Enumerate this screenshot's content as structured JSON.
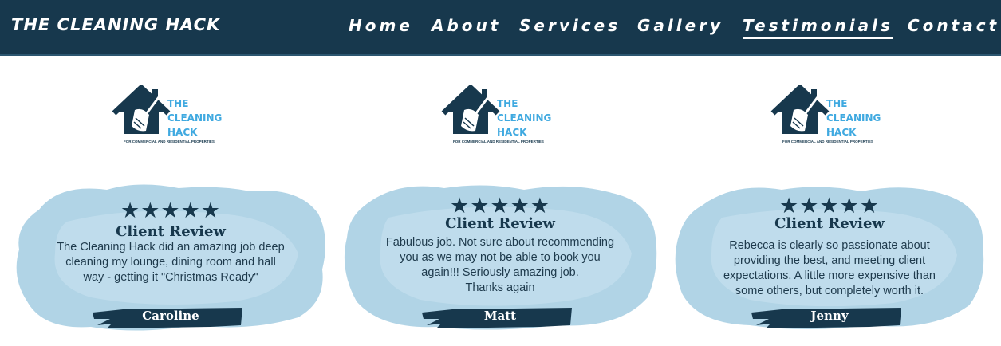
{
  "header": {
    "brand": "THE CLEANING HACK",
    "nav": [
      {
        "label": "Home"
      },
      {
        "label": "About"
      },
      {
        "label": "Services"
      },
      {
        "label": "Gallery"
      },
      {
        "label": "Testimonials",
        "active": true
      },
      {
        "label": "Contact"
      }
    ]
  },
  "logo": {
    "line1": "THE",
    "line2": "CLEANING",
    "line3": "HACK",
    "tagline": "FOR COMMERCIAL AND RESIDENTIAL PROPERTIES",
    "icon": "house-broom-icon"
  },
  "reviews": [
    {
      "stars": "★★★★★",
      "rating": 5,
      "title": "Client Review",
      "lines": [
        "The Cleaning Hack did an amazing job deep",
        "cleaning my lounge, dining room and hall",
        "way - getting it \"Christmas Ready\""
      ],
      "name": "Caroline"
    },
    {
      "stars": "★★★★★",
      "rating": 5,
      "title": "Client Review",
      "lines": [
        "Fabulous job. Not sure about recommending",
        "you as we may not be able to book you",
        "again!!! Seriously amazing job.",
        "Thanks again"
      ],
      "name": "Matt"
    },
    {
      "stars": "★★★★★",
      "rating": 5,
      "title": "Client Review",
      "lines": [
        "Rebecca is clearly so passionate about",
        "providing the best, and meeting client",
        "expectations. A little more expensive than",
        "some others, but completely worth it."
      ],
      "name": "Jenny"
    }
  ],
  "colors": {
    "header_bg": "#17384d",
    "accent_blue": "#3fa9e0",
    "cloud": "#a9cfe3",
    "text_dark": "#17384d"
  }
}
